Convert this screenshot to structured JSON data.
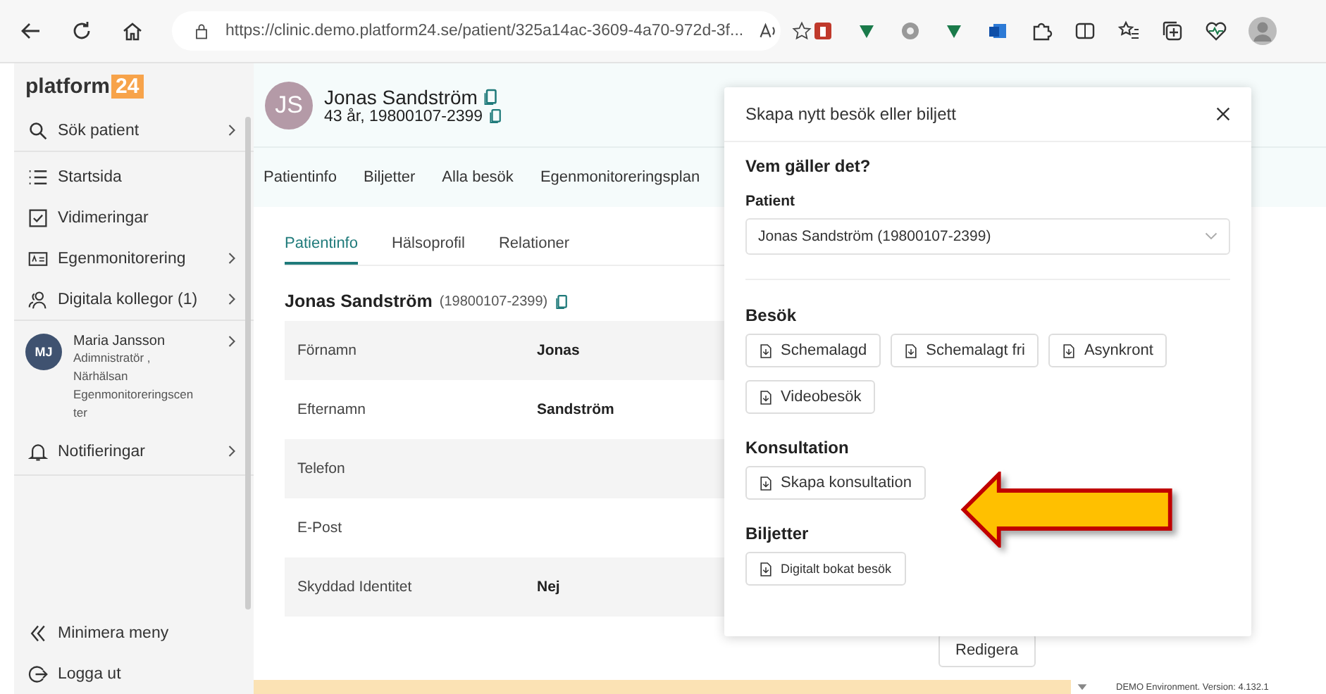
{
  "browser": {
    "url": "https://clinic.demo.platform24.se/patient/325a14ac-3609-4a70-972d-3f..."
  },
  "sidebar": {
    "logo": {
      "text": "platform",
      "badge": "24"
    },
    "items": [
      {
        "label": "Sök patient",
        "expandable": true,
        "divider_after": true
      },
      {
        "label": "Startsida",
        "expandable": false,
        "divider_after": false
      },
      {
        "label": "Vidimeringar",
        "expandable": false,
        "divider_after": false
      },
      {
        "label": "Egenmonitorering",
        "expandable": true,
        "divider_after": false
      },
      {
        "label": "Digitala kollegor (1)",
        "expandable": true,
        "divider_after": true
      }
    ],
    "user": {
      "initials": "MJ",
      "name": "Maria Jansson",
      "role_lines": [
        "Adimnistratör ,",
        "Närhälsan",
        "Egenmonitoreringscen",
        "ter"
      ]
    },
    "notifications": {
      "label": "Notifieringar"
    },
    "footer_items": [
      {
        "label": "Minimera meny"
      },
      {
        "label": "Logga ut"
      }
    ]
  },
  "patient": {
    "initials": "JS",
    "name": "Jonas Sandström",
    "details": "43 år, 19800107-2399"
  },
  "tabs": [
    {
      "label": "Patientinfo",
      "selected": false
    },
    {
      "label": "Biljetter",
      "selected": false
    },
    {
      "label": "Alla besök",
      "selected": false
    },
    {
      "label": "Egenmonitoreringsplan",
      "selected": false
    }
  ],
  "subtabs": [
    {
      "label": "Patientinfo",
      "selected": true
    },
    {
      "label": "Hälsoprofil",
      "selected": false
    },
    {
      "label": "Relationer",
      "selected": false
    }
  ],
  "section": {
    "name": "Jonas Sandström",
    "id": "(19800107-2399)"
  },
  "rows": [
    {
      "label": "Förnamn",
      "value": "Jonas"
    },
    {
      "label": "Efternamn",
      "value": "Sandström"
    },
    {
      "label": "Telefon"
    },
    {
      "label": "E-Post"
    },
    {
      "label": "Skyddad Identitet",
      "value": "Nej"
    }
  ],
  "edit_button": "Redigera",
  "version": "DEMO Environment. Version: 4.132.1",
  "modal": {
    "title": "Skapa nytt besök eller biljett",
    "question": "Vem gäller det?",
    "patient_label": "Patient",
    "patient_value": "Jonas Sandström (19800107-2399)",
    "groups": [
      {
        "title": "Besök",
        "buttons": [
          "Schemalagd",
          "Schemalagt fri",
          "Asynkront",
          "Videobesök"
        ]
      },
      {
        "title": "Konsultation",
        "buttons": [
          "Skapa konsultation"
        ]
      },
      {
        "title": "Biljetter",
        "buttons": [
          "Digitalt bokat besök"
        ]
      }
    ]
  }
}
